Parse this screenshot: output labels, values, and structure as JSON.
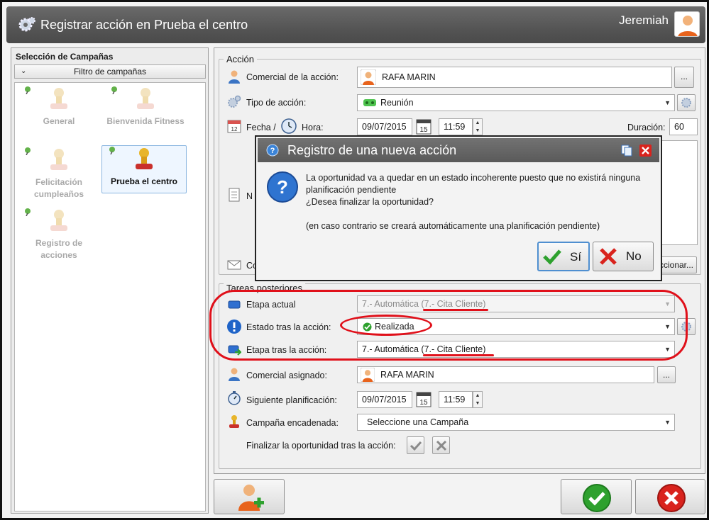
{
  "window": {
    "title": "Registrar acción en Prueba el centro",
    "user": "Jeremiah"
  },
  "campaigns": {
    "header": "Selección de Campañas",
    "filter_label": "Filtro de campañas",
    "items": [
      {
        "label": "General"
      },
      {
        "label": "Bienvenida Fitness"
      },
      {
        "label": "Felicitación cumpleaños"
      },
      {
        "label": "Prueba el centro"
      },
      {
        "label": "Registro de acciones"
      }
    ]
  },
  "accion": {
    "legend": "Acción",
    "comercial_label": "Comercial de la acción:",
    "comercial_value": "RAFA MARIN",
    "tipo_label": "Tipo de acción:",
    "tipo_value": "Reunión",
    "fecha_label": "Fecha /",
    "hora_label": "Hora:",
    "fecha_value": "09/07/2015",
    "cal_day": "15",
    "hora_value": "11:59",
    "duracion_label": "Duración:",
    "duracion_value": "60",
    "notas_label_partial": "N",
    "contacto_label_partial": "Co",
    "seleccionar_partial": "ccionar..."
  },
  "tareas": {
    "legend": "Tareas posteriores",
    "etapa_actual_label": "Etapa actual",
    "etapa_actual_value": "7.- Automática (7.- Cita Cliente)",
    "estado_label": "Estado tras la acción:",
    "estado_value": "Realizada",
    "etapa_tras_label": "Etapa tras la acción:",
    "etapa_tras_value": "7.- Automática (7.- Cita Cliente)",
    "comercial_asignado_label": "Comercial asignado:",
    "comercial_asignado_value": "RAFA MARIN",
    "siguiente_label": "Siguiente planificación:",
    "siguiente_fecha": "09/07/2015",
    "siguiente_hora": "11:59",
    "campana_label": "Campaña encadenada:",
    "campana_value": "Seleccione una Campaña",
    "finalizar_label": "Finalizar la oportunidad tras la acción:"
  },
  "buttons": {
    "ellipsis": "..."
  },
  "dialog": {
    "title": "Registro de una nueva acción",
    "line1": "La oportunidad va a quedar en un estado incoherente puesto que no existirá ninguna planificación pendiente",
    "line2": "¿Desea finalizar la oportunidad?",
    "line3": "(en caso contrario se creará automáticamente una planificación pendiente)",
    "yes_label": "Sí",
    "no_label": "No"
  },
  "colors": {
    "annotation_red": "#e0101a",
    "titlebar": "#5a5a5a",
    "ok_green": "#2ea12e",
    "cancel_red": "#d9231d"
  }
}
